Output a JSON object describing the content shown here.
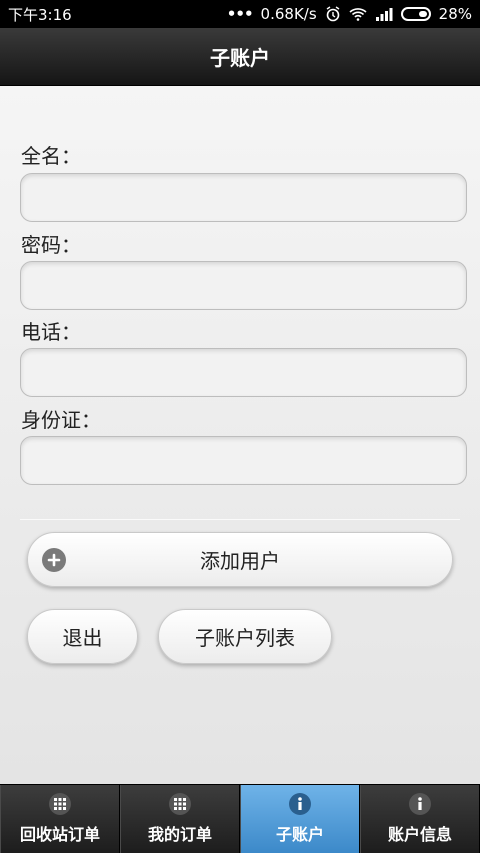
{
  "status_bar": {
    "time": "下午3:16",
    "network_speed": "0.68K/s",
    "battery": "28%"
  },
  "header": {
    "title": "子账户"
  },
  "form": {
    "fields": [
      {
        "label": "全名：",
        "value": ""
      },
      {
        "label": "密码：",
        "value": ""
      },
      {
        "label": "电话：",
        "value": ""
      },
      {
        "label": "身份证：",
        "value": ""
      }
    ]
  },
  "buttons": {
    "add_user": "添加用户",
    "logout": "退出",
    "subaccount_list": "子账户列表"
  },
  "tabs": [
    {
      "label": "回收站订单",
      "icon": "grid-icon",
      "active": false
    },
    {
      "label": "我的订单",
      "icon": "grid-icon",
      "active": false
    },
    {
      "label": "子账户",
      "icon": "info-icon",
      "active": true
    },
    {
      "label": "账户信息",
      "icon": "info-icon",
      "active": false
    }
  ],
  "colors": {
    "active_tab": "#4a96d6",
    "header_bg": "#1e1e1e"
  }
}
